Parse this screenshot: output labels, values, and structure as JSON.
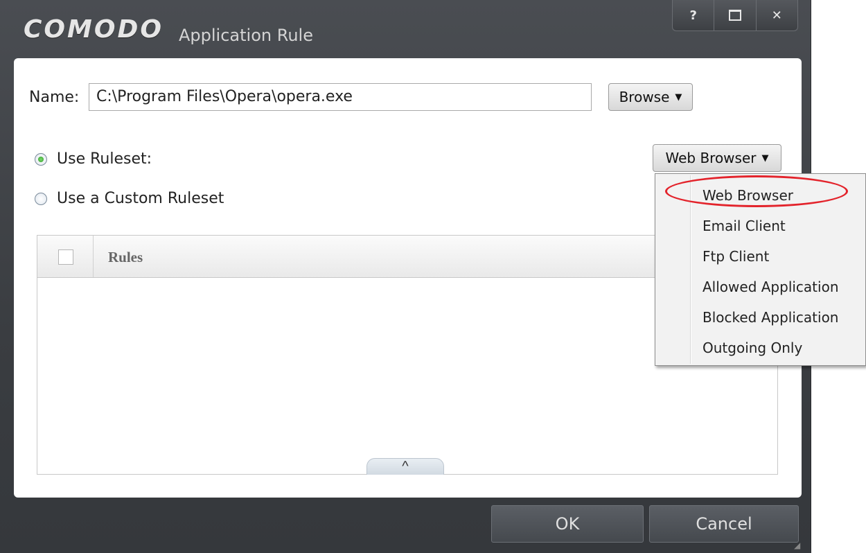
{
  "titlebar": {
    "brand": "COMODO",
    "title": "Application Rule",
    "controls": {
      "help": "?",
      "close": "✕"
    }
  },
  "name_field": {
    "label": "Name:",
    "value": "C:\\Program Files\\Opera\\opera.exe",
    "browse_label": "Browse"
  },
  "ruleset": {
    "use_ruleset_label": "Use Ruleset:",
    "use_custom_label": "Use a Custom Ruleset",
    "selected": "Web Browser",
    "options": [
      "Web Browser",
      "Email Client",
      "Ftp Client",
      "Allowed Application",
      "Blocked Application",
      "Outgoing Only"
    ],
    "highlight_color": "#e3232b"
  },
  "rules_table": {
    "header": "Rules",
    "collapse_icon": "^"
  },
  "footer": {
    "ok_label": "OK",
    "cancel_label": "Cancel"
  }
}
